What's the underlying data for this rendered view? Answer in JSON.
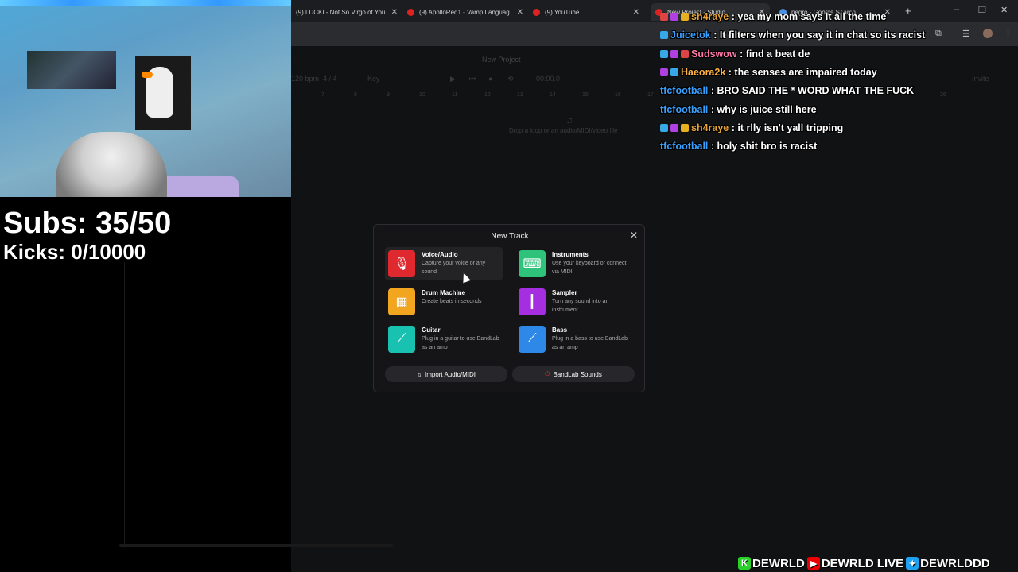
{
  "browser": {
    "tabs": [
      {
        "label": "(9) LUCKI - Not So Virgo of You"
      },
      {
        "label": "(9) ApolloRed1 - Vamp Languag"
      },
      {
        "label": "(9) YouTube"
      },
      {
        "label": "New Project - Studio"
      },
      {
        "label": "negro - Google Search"
      }
    ]
  },
  "daw": {
    "title": "New Project",
    "tempo": "120 bpm",
    "signature": "4 / 4",
    "key": "Key",
    "time": "00:00.0",
    "invite": "Invite",
    "drop_hint": "Drop a loop or an audio/MIDI/video file",
    "ruler": [
      "7",
      "8",
      "9",
      "10",
      "11",
      "12",
      "13",
      "14",
      "15",
      "16",
      "17"
    ],
    "ruler_right": "26"
  },
  "overlay": {
    "subs": "Subs: 35/50",
    "kicks": "Kicks: 0/10000"
  },
  "chat": [
    {
      "user": "sh4raye",
      "color": "#e8a43a",
      "badges": [
        "b-sub",
        "b-mod",
        "b-crown"
      ],
      "text": "yea my mom says it all the time"
    },
    {
      "user": "Juicetok",
      "color": "#3aa0ff",
      "badges": [
        "b-cube"
      ],
      "text": "It filters when you say it in chat so its racist"
    },
    {
      "user": "Sudswow",
      "color": "#ff7aa8",
      "badges": [
        "b-cube",
        "b-mod",
        "b-sub"
      ],
      "text": "find a beat de"
    },
    {
      "user": "Haeora2k",
      "color": "#ffb347",
      "badges": [
        "b-mod",
        "b-cube"
      ],
      "text": "the senses are impaired today"
    },
    {
      "user": "tfcfootball",
      "color": "#3aa0ff",
      "badges": [],
      "text": "BRO SAID THE * WORD WHAT THE FUCK"
    },
    {
      "user": "tfcfootball",
      "color": "#3aa0ff",
      "badges": [],
      "text": "why is juice still here"
    },
    {
      "user": "sh4raye",
      "color": "#e8a43a",
      "badges": [
        "b-cube",
        "b-mod",
        "b-crown"
      ],
      "text": "it rlly isn't yall tripping"
    },
    {
      "user": "tfcfootball",
      "color": "#3aa0ff",
      "badges": [],
      "text": "holy shit bro is racist"
    }
  ],
  "modal": {
    "title": "New Track",
    "options": [
      {
        "title": "Voice/Audio",
        "desc": "Capture your voice or any sound",
        "color": "#e0282f",
        "icon": "microphone-icon"
      },
      {
        "title": "Instruments",
        "desc": "Use your keyboard or connect via MIDI",
        "color": "#2fc27a",
        "icon": "keyboard-icon"
      },
      {
        "title": "Drum Machine",
        "desc": "Create beats in seconds",
        "color": "#f2a51f",
        "icon": "drum-machine-icon"
      },
      {
        "title": "Sampler",
        "desc": "Turn any sound into an instrument",
        "color": "#a52ee0",
        "icon": "waveform-icon"
      },
      {
        "title": "Guitar",
        "desc": "Plug in a guitar to use BandLab as an amp",
        "color": "#19c2b0",
        "icon": "guitar-icon"
      },
      {
        "title": "Bass",
        "desc": "Plug in a bass to use BandLab as an amp",
        "color": "#2e88e8",
        "icon": "bass-icon"
      }
    ],
    "import_label": "Import Audio/MIDI",
    "sounds_label": "BandLab Sounds"
  },
  "branding": {
    "kick": "DEWRLD",
    "youtube": "DEWRLD LIVE",
    "twitter": "DEWRLDDD"
  }
}
